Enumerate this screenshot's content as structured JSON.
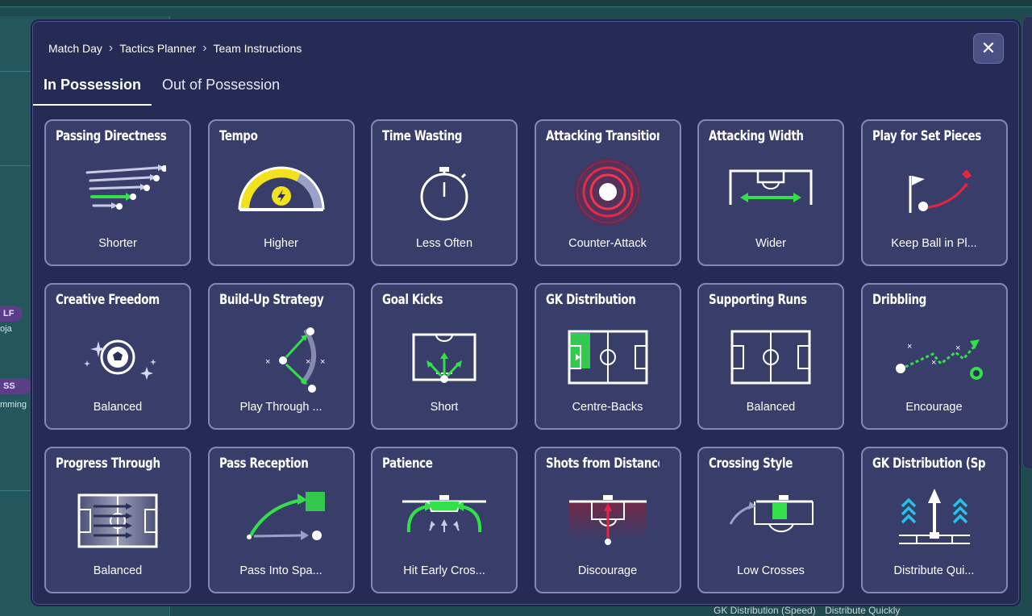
{
  "background": {
    "chip_lf": "LF",
    "text_oja": "oja",
    "chip_ss": "SS",
    "text_mming": "mming",
    "bottom_label": "GK Distribution (Speed)",
    "bottom_value": "Distribute Quickly"
  },
  "modal": {
    "breadcrumb": [
      "Match Day",
      "Tactics Planner",
      "Team Instructions"
    ],
    "close_icon": "close-icon",
    "tabs": [
      {
        "label": "In Possession",
        "active": true
      },
      {
        "label": "Out of Possession",
        "active": false
      }
    ],
    "cards": [
      {
        "title": "Passing Directness",
        "value": "Shorter",
        "icon": "passing-arrows-icon"
      },
      {
        "title": "Tempo",
        "value": "Higher",
        "icon": "tempo-gauge-icon"
      },
      {
        "title": "Time Wasting",
        "value": "Less Often",
        "icon": "stopwatch-icon"
      },
      {
        "title": "Attacking Transition",
        "value": "Counter-Attack",
        "icon": "target-rings-icon"
      },
      {
        "title": "Attacking Width",
        "value": "Wider",
        "icon": "width-arrow-icon"
      },
      {
        "title": "Play for Set Pieces",
        "value": "Keep Ball in Pl...",
        "icon": "set-piece-flag-icon"
      },
      {
        "title": "Creative Freedom",
        "value": "Balanced",
        "icon": "sparkle-ball-icon"
      },
      {
        "title": "Build-Up Strategy",
        "value": "Play Through ...",
        "icon": "build-up-icon"
      },
      {
        "title": "Goal Kicks",
        "value": "Short",
        "icon": "goal-kick-icon"
      },
      {
        "title": "GK Distribution",
        "value": "Centre-Backs",
        "icon": "pitch-highlight-icon"
      },
      {
        "title": "Supporting Runs",
        "value": "Balanced",
        "icon": "pitch-icon"
      },
      {
        "title": "Dribbling",
        "value": "Encourage",
        "icon": "dribble-path-icon"
      },
      {
        "title": "Progress Through",
        "value": "Balanced",
        "icon": "progress-pitch-icon"
      },
      {
        "title": "Pass Reception",
        "value": "Pass Into Spa...",
        "icon": "pass-reception-icon"
      },
      {
        "title": "Patience",
        "value": "Hit Early Cros...",
        "icon": "patience-icon"
      },
      {
        "title": "Shots from Distance",
        "value": "Discourage",
        "icon": "shots-distance-icon"
      },
      {
        "title": "Crossing Style",
        "value": "Low Crosses",
        "icon": "crossing-icon"
      },
      {
        "title": "GK Distribution (Speed)",
        "value": "Distribute Qui...",
        "icon": "distribution-speed-icon"
      }
    ]
  }
}
